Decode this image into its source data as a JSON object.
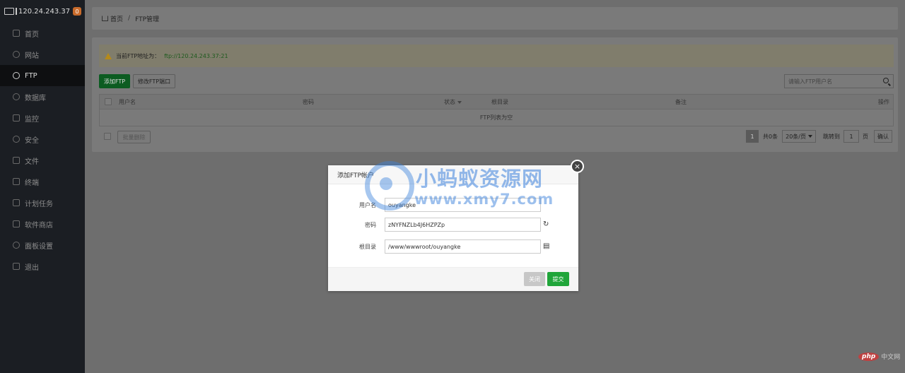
{
  "sidebar": {
    "host": "120.24.243.37",
    "badge": "0",
    "items": [
      {
        "label": "首页",
        "icon": "home-icon"
      },
      {
        "label": "网站",
        "icon": "globe-icon"
      },
      {
        "label": "FTP",
        "icon": "ftp-icon",
        "active": true
      },
      {
        "label": "数据库",
        "icon": "database-icon"
      },
      {
        "label": "监控",
        "icon": "monitor-icon"
      },
      {
        "label": "安全",
        "icon": "shield-icon"
      },
      {
        "label": "文件",
        "icon": "folder-icon"
      },
      {
        "label": "终端",
        "icon": "terminal-icon"
      },
      {
        "label": "计划任务",
        "icon": "calendar-icon"
      },
      {
        "label": "软件商店",
        "icon": "apps-icon"
      },
      {
        "label": "面板设置",
        "icon": "settings-icon"
      },
      {
        "label": "退出",
        "icon": "logout-icon"
      }
    ]
  },
  "breadcrumb": {
    "home": "首页",
    "separator": "/",
    "current": "FTP管理"
  },
  "alert": {
    "label": "当前FTP地址为：",
    "address": "ftp://120.24.243.37:21"
  },
  "toolbar": {
    "add_label": "添加FTP",
    "port_label": "修改FTP端口",
    "search_placeholder": "请输入FTP用户名"
  },
  "table": {
    "headers": {
      "username": "用户名",
      "password": "密码",
      "status": "状态",
      "root": "根目录",
      "note": "备注",
      "ops": "操作"
    },
    "empty_text": "FTP列表为空"
  },
  "footer": {
    "batch_delete": "批量删除",
    "page": "1",
    "total": "共0条",
    "per_page": "20条/页",
    "jump_label": "跳转到",
    "jump_value": "1",
    "page_unit": "页",
    "confirm": "确认"
  },
  "modal": {
    "title": "添加FTP帐户",
    "username_label": "用户名",
    "username_value": "ouyangke",
    "password_label": "密码",
    "password_value": "zNYFNZLb4J6HZPZp",
    "root_label": "根目录",
    "root_value": "/www/wwwroot/ouyangke",
    "close_label": "关闭",
    "submit_label": "提交"
  },
  "watermark": {
    "cn": "小蚂蚁资源网",
    "url": "www.xmy7.com",
    "php": "php",
    "php_site": "中文网"
  },
  "colors": {
    "accent": "#20a53a",
    "sidebar_bg": "#1b1e23",
    "badge": "#c96b2b"
  }
}
